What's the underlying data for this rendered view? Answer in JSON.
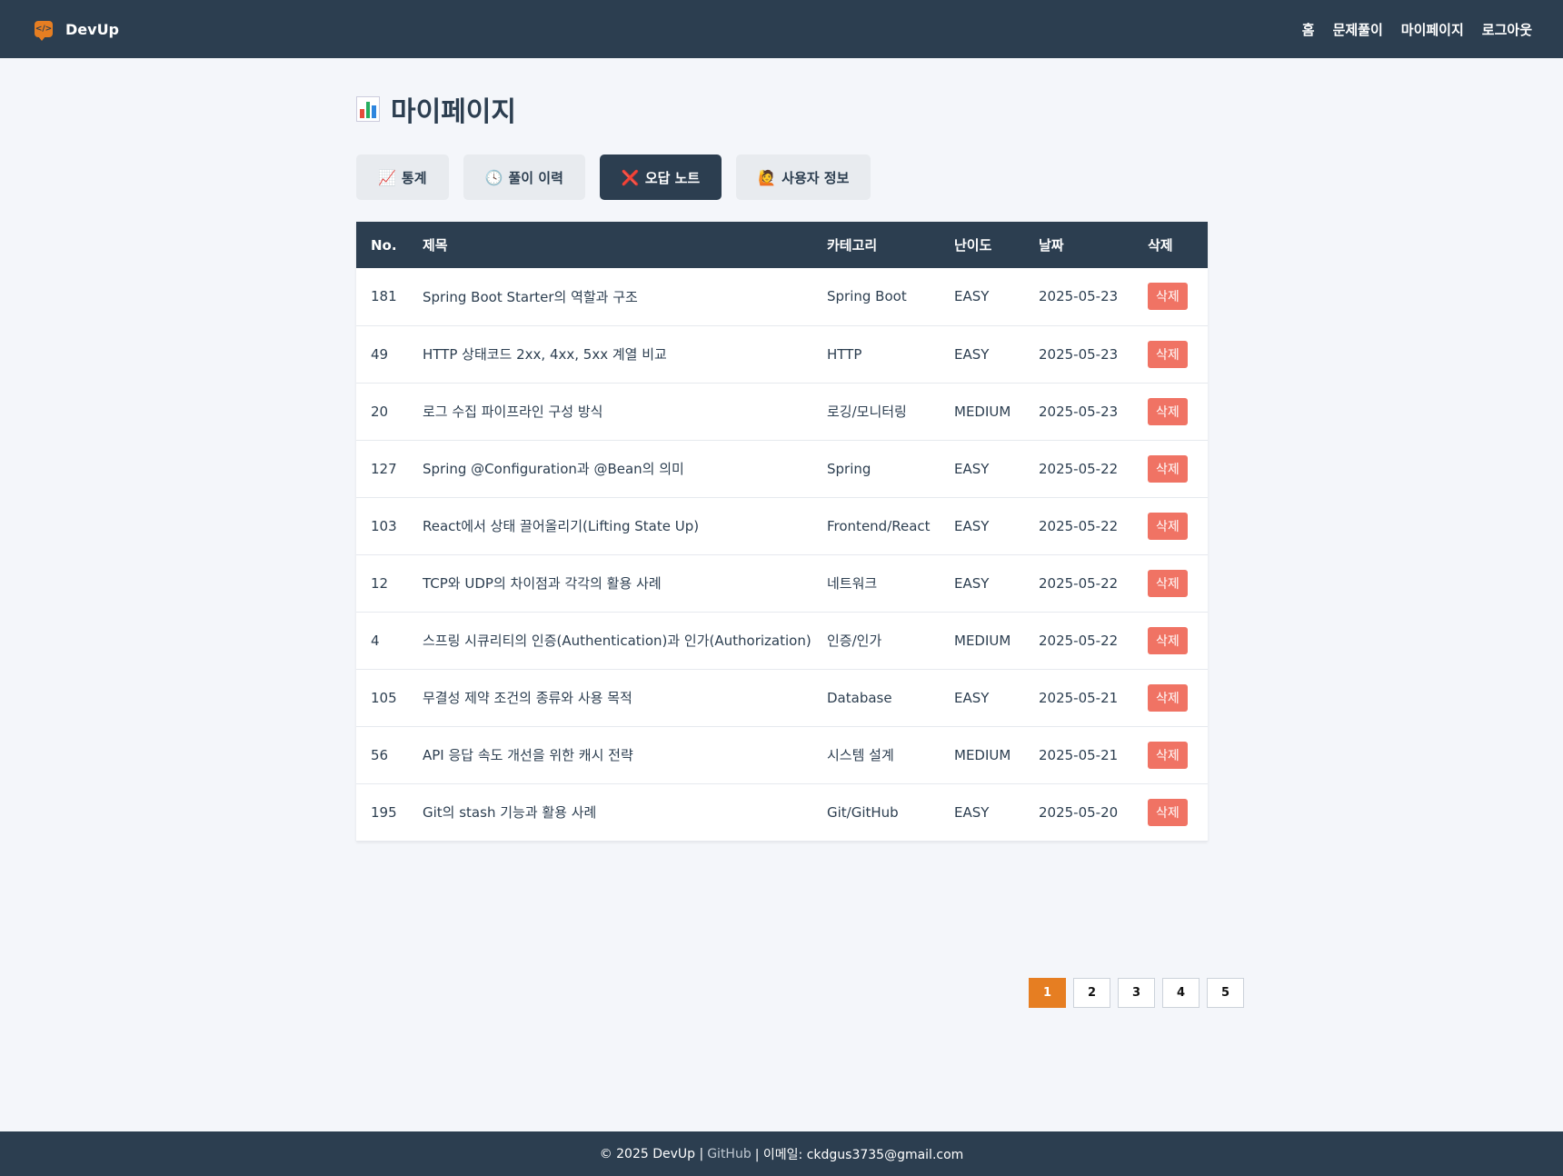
{
  "header": {
    "brand": "DevUp",
    "nav": [
      "홈",
      "문제풀이",
      "마이페이지",
      "로그아웃"
    ]
  },
  "page": {
    "title": "마이페이지",
    "tabs": [
      {
        "icon": "📈",
        "label": "통계"
      },
      {
        "icon": "🕓",
        "label": "풀이 이력"
      },
      {
        "icon": "❌",
        "label": "오답 노트"
      },
      {
        "icon": "🙋",
        "label": "사용자 정보"
      }
    ],
    "active_tab": "오답 노트"
  },
  "table": {
    "columns": [
      "No.",
      "제목",
      "카테고리",
      "난이도",
      "날짜",
      "삭제"
    ],
    "delete_label": "삭제",
    "rows": [
      {
        "no": "181",
        "title": "Spring Boot Starter의 역할과 구조",
        "category": "Spring Boot",
        "level": "EASY",
        "date": "2025-05-23"
      },
      {
        "no": "49",
        "title": "HTTP 상태코드 2xx, 4xx, 5xx 계열 비교",
        "category": "HTTP",
        "level": "EASY",
        "date": "2025-05-23"
      },
      {
        "no": "20",
        "title": "로그 수집 파이프라인 구성 방식",
        "category": "로깅/모니터링",
        "level": "MEDIUM",
        "date": "2025-05-23"
      },
      {
        "no": "127",
        "title": "Spring @Configuration과 @Bean의 의미",
        "category": "Spring",
        "level": "EASY",
        "date": "2025-05-22"
      },
      {
        "no": "103",
        "title": "React에서 상태 끌어올리기(Lifting State Up)",
        "category": "Frontend/React",
        "level": "EASY",
        "date": "2025-05-22"
      },
      {
        "no": "12",
        "title": "TCP와 UDP의 차이점과 각각의 활용 사례",
        "category": "네트워크",
        "level": "EASY",
        "date": "2025-05-22"
      },
      {
        "no": "4",
        "title": "스프링 시큐리티의 인증(Authentication)과 인가(Authorization)",
        "category": "인증/인가",
        "level": "MEDIUM",
        "date": "2025-05-22"
      },
      {
        "no": "105",
        "title": "무결성 제약 조건의 종류와 사용 목적",
        "category": "Database",
        "level": "EASY",
        "date": "2025-05-21"
      },
      {
        "no": "56",
        "title": "API 응답 속도 개선을 위한 캐시 전략",
        "category": "시스템 설계",
        "level": "MEDIUM",
        "date": "2025-05-21"
      },
      {
        "no": "195",
        "title": "Git의 stash 기능과 활용 사례",
        "category": "Git/GitHub",
        "level": "EASY",
        "date": "2025-05-20"
      }
    ]
  },
  "pagination": {
    "pages": [
      "1",
      "2",
      "3",
      "4",
      "5"
    ],
    "current": "1"
  },
  "footer": {
    "copyright": "© 2025 DevUp |",
    "github": "GitHub",
    "email_text": "| 이메일: ckdgus3735@gmail.com"
  },
  "colors": {
    "navy": "#2c3e50",
    "accent": "#e67e22",
    "delete": "#f07364"
  }
}
